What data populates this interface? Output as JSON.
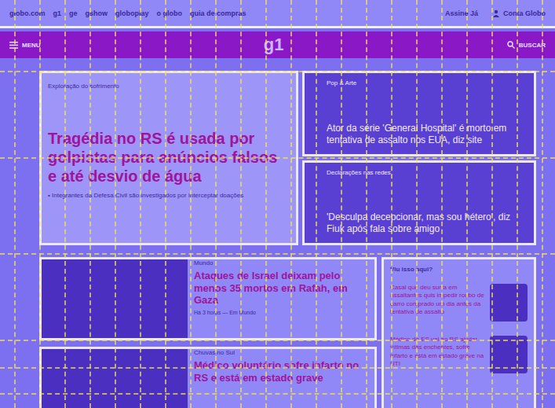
{
  "topbar": {
    "links": [
      "globo.com",
      "g1",
      "ge",
      "gshow",
      "globoplay",
      "o globo",
      "guia de compras"
    ],
    "subscribe": "Assine Já",
    "account": "Conta Globo"
  },
  "navbar": {
    "menu": "MENU",
    "logo": "g1",
    "search": "BUSCAR"
  },
  "hero": {
    "label": "Exploração do sofrimento",
    "headline": "Tragédia no RS é usada por golpistas para anúncios falsos e até desvio de água",
    "bullet": "Integrantes da Defesa Civil são investigados por interceptar doações"
  },
  "side_stories": [
    {
      "label": "Pop & Arte",
      "headline": "Ator da série 'General Hospital' é morto em tentativa de assalto nos EUA, diz site"
    },
    {
      "label": "Declarações nas redes",
      "headline": "'Desculpa decepcionar, mas sou hétero', diz Fiuk após fala sobre amigo"
    }
  ],
  "feed": [
    {
      "label": "Mundo",
      "headline": "Ataques de Israel deixam pelo menos 35 mortos em Rafah, em Gaza",
      "meta": "Há 3 horas — Em Mundo"
    },
    {
      "label": "Chuvas no Sul",
      "headline": "Médico voluntário sofre infarto no RS e está em estado grave",
      "meta": ""
    }
  ],
  "sidebar": {
    "title": "Viu isso aqui?",
    "items": [
      "Casal que deu surra em assaltantes quis impedir roubo de carro comprado um dia antes da tentativa de assalto",
      "Médico do ES vai ao RS ajudar vítimas das enchentes, sofre infarto e está em estado grave na UTI"
    ]
  }
}
